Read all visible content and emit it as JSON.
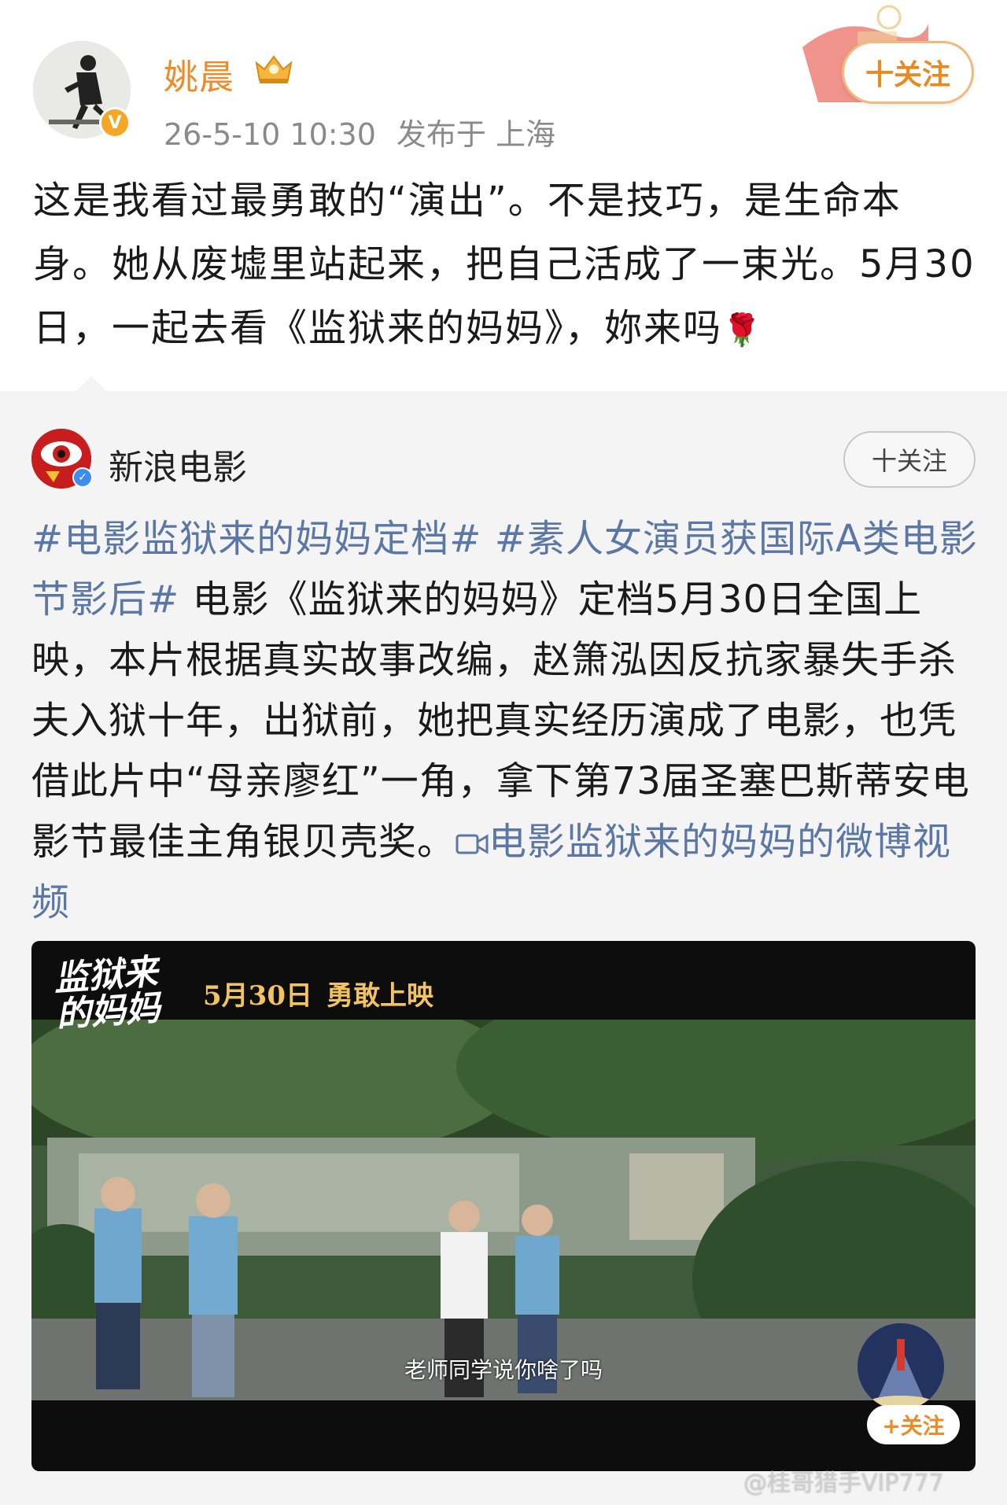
{
  "post": {
    "author_name": "姚晨",
    "time": "26-5-10 10:30",
    "location": "发布于 上海",
    "follow_label": "十关注",
    "verified_mark": "V",
    "text": "这是我看过最勇敢的“演出”。不是技巧，是生命本身。她从废墟里站起来，把自己活成了一束光。5月30日，一起去看《监狱来的妈妈》，妳来吗",
    "emoji": "🌹"
  },
  "repost": {
    "author_name": "新浪电影",
    "follow_label": "十关注",
    "topic1": "#电影监狱来的妈妈定档#",
    "topic2": "#素人女演员获国际A类电影节影后#",
    "body": "电影《监狱来的妈妈》定档5月30日全国上映，本片根据真实故事改编，赵箫泓因反抗家暴失手杀夫入狱十年，出狱前，她把真实经历演成了电影，也凭借此片中“母亲廖红”一角，拿下第73届圣塞巴斯蒂安电影节最佳主角银贝壳奖。",
    "video_link": "电影监狱来的妈妈的微博视频"
  },
  "video": {
    "logo_text": "监狱来的妈妈",
    "date_text": "5月30日",
    "tagline_text": "勇敢上映",
    "subtitle": "老师同学说你啥了吗",
    "follow_label": "+关注"
  },
  "watermark": "@桂哥猎手VIP777",
  "colors": {
    "author_name": "#f08a24",
    "topic_link": "#5b77a6",
    "meta_gray": "#8a8a8a",
    "repost_bg": "#f4f4f5"
  }
}
